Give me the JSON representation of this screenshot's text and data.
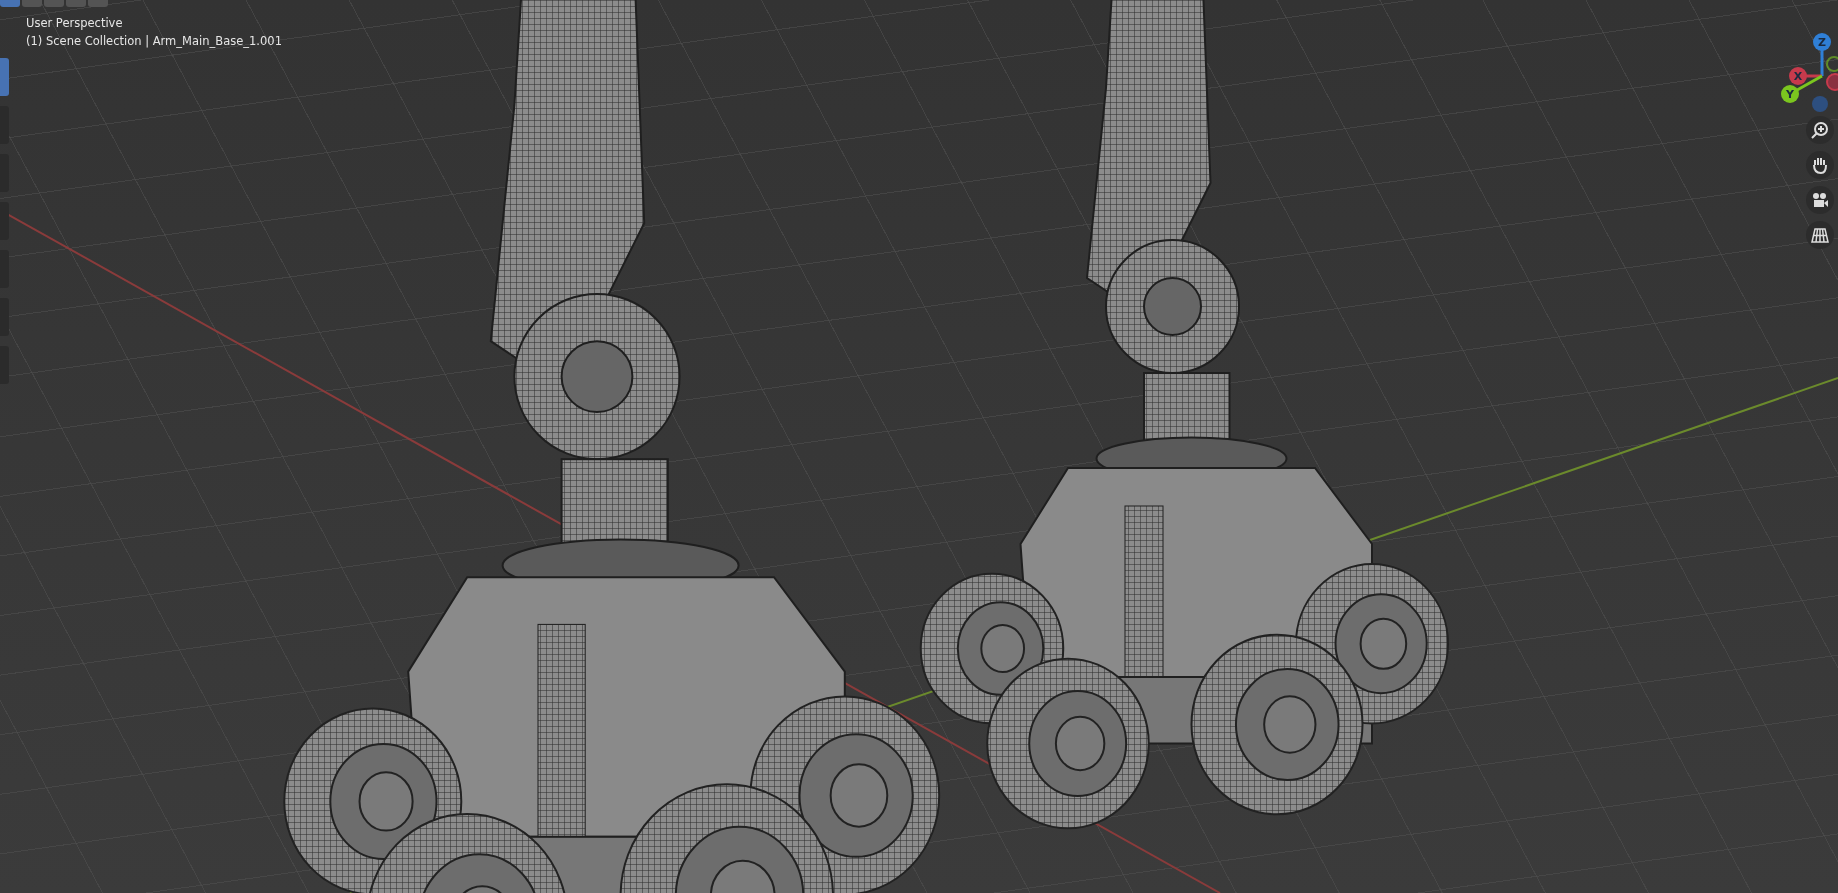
{
  "viewport": {
    "view_name": "User Perspective",
    "collection_label": "(1) Scene Collection | Arm_Main_Base_1.001"
  },
  "header_modes": [
    {
      "selected": true
    },
    {
      "selected": false
    },
    {
      "selected": false
    },
    {
      "selected": false
    },
    {
      "selected": false
    }
  ],
  "toolbar": {
    "tools": [
      {
        "selected": true
      },
      {
        "selected": false
      },
      {
        "selected": false
      },
      {
        "selected": false
      },
      {
        "selected": false
      },
      {
        "selected": false
      },
      {
        "selected": false
      }
    ]
  },
  "gizmo": {
    "axes": [
      {
        "label": "Z",
        "color": "#2f7fd6"
      },
      {
        "label": "X",
        "color": "#c73a4c"
      },
      {
        "label": "Y",
        "color": "#7bc61f"
      }
    ]
  }
}
